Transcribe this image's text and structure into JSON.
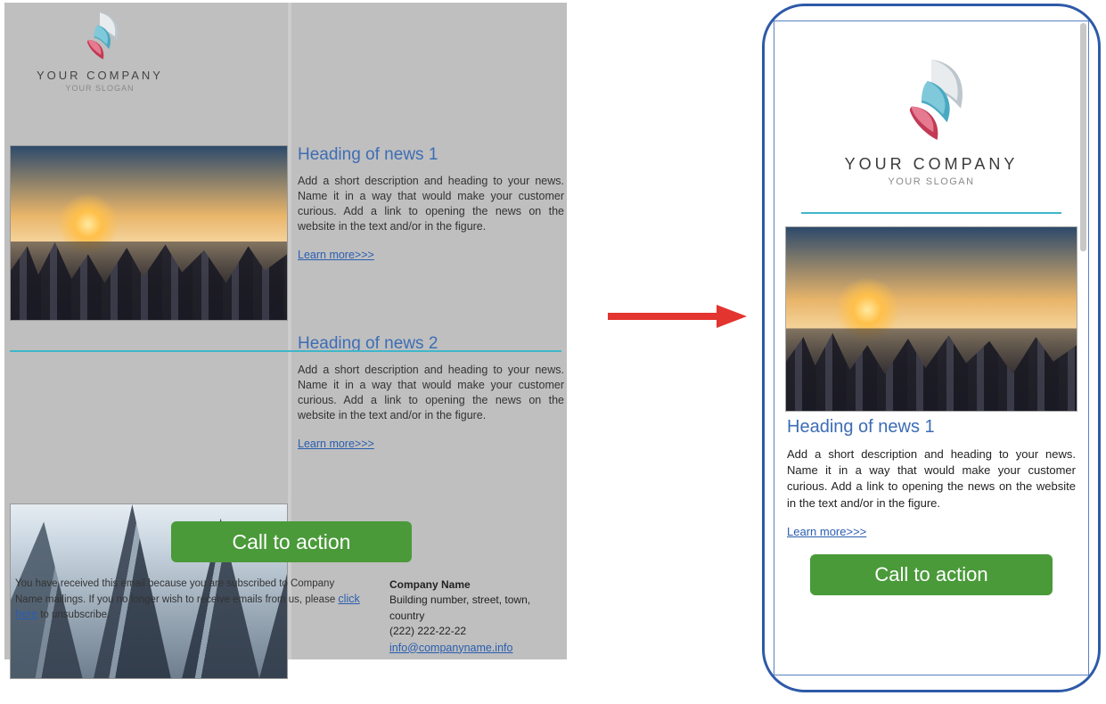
{
  "logo": {
    "company": "YOUR COMPANY",
    "slogan": "YOUR SLOGAN"
  },
  "desktop": {
    "news": [
      {
        "heading": "Heading of news 1",
        "body": "Add a short description and heading to your news. Name it in a way that would make your customer curious. Add a link to opening the news on the website in the text and/or in the figure.",
        "learn": "Learn more>>>"
      },
      {
        "heading": "Heading of news 2",
        "body": "Add a short description and heading to your news. Name it in a way that would make your customer curious. Add a link to opening the news on the website in the text and/or in the figure.",
        "learn": "Learn more>>>"
      }
    ],
    "cta": "Call to action",
    "footer": {
      "unsub_1": "You have received this email because you are subscribed to Company Name mailings. If you no longer wish to receive emails from us, please ",
      "unsub_link": "click here",
      "unsub_2": " to unsubscribe.",
      "company": "Company Name",
      "address": "Building number, street, town, country",
      "phone": "(222) 222-22-22",
      "email": "info@companyname.info"
    }
  },
  "mobile": {
    "news": {
      "heading": "Heading of news 1",
      "body": "Add a short description and heading to your news. Name it in a way that would make your customer curious. Add a link to opening the news on the website in the text and/or in the figure.",
      "learn": "Learn more>>>"
    },
    "cta": "Call to action"
  }
}
